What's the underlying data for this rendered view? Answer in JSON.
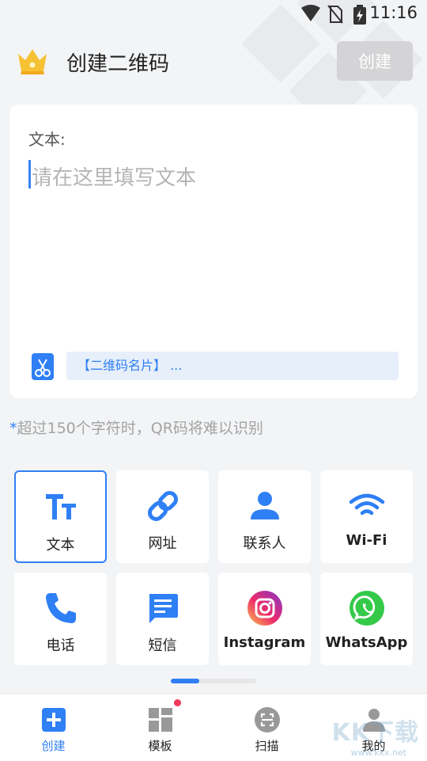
{
  "status_bar": {
    "time": "11:16"
  },
  "header": {
    "title": "创建二维码",
    "create_label": "创建"
  },
  "text_card": {
    "label": "文本:",
    "placeholder": "请在这里填写文本",
    "template_chip": "【二维码名片】 ..."
  },
  "hint": {
    "star": "*",
    "text": "超过150个字符时，QR码将难以识别"
  },
  "types": [
    {
      "label": "文本",
      "icon": "text-format-icon",
      "selected": true
    },
    {
      "label": "网址",
      "icon": "link-icon",
      "selected": false
    },
    {
      "label": "联系人",
      "icon": "person-icon",
      "selected": false
    },
    {
      "label": "Wi-Fi",
      "icon": "wifi-icon",
      "selected": false
    },
    {
      "label": "电话",
      "icon": "phone-icon",
      "selected": false
    },
    {
      "label": "短信",
      "icon": "message-icon",
      "selected": false
    },
    {
      "label": "Instagram",
      "icon": "instagram-icon",
      "selected": false
    },
    {
      "label": "WhatsApp",
      "icon": "whatsapp-icon",
      "selected": false
    }
  ],
  "bottom_nav": [
    {
      "label": "创建",
      "icon": "create-plus-icon",
      "active": true
    },
    {
      "label": "模板",
      "icon": "template-grid-icon",
      "active": false
    },
    {
      "label": "扫描",
      "icon": "scan-icon",
      "active": false
    },
    {
      "label": "我的",
      "icon": "profile-icon",
      "active": false
    }
  ],
  "watermark": {
    "text": "KK下载",
    "url": "www.kkx.net"
  },
  "colors": {
    "accent": "#2f7ff5",
    "disabled_button": "#d4d4d6",
    "badge": "#ef3b5a"
  }
}
